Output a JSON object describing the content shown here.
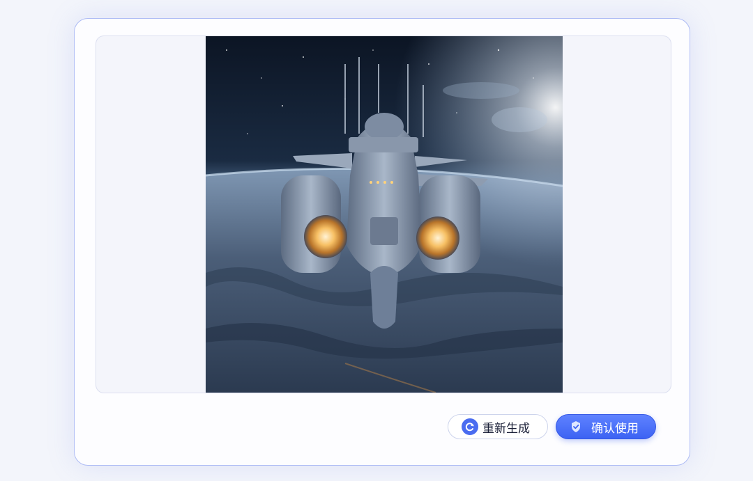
{
  "dialog": {
    "image": {
      "subject": "spaceship-over-planet"
    },
    "actions": {
      "regenerate_label": "重新生成",
      "confirm_label": "确认使用",
      "regenerate_icon": "refresh-icon",
      "confirm_icon": "check-shield-icon"
    },
    "colors": {
      "accent": "#3d63f3",
      "border": "#aebcf5",
      "panel": "#f4f5fb"
    }
  }
}
